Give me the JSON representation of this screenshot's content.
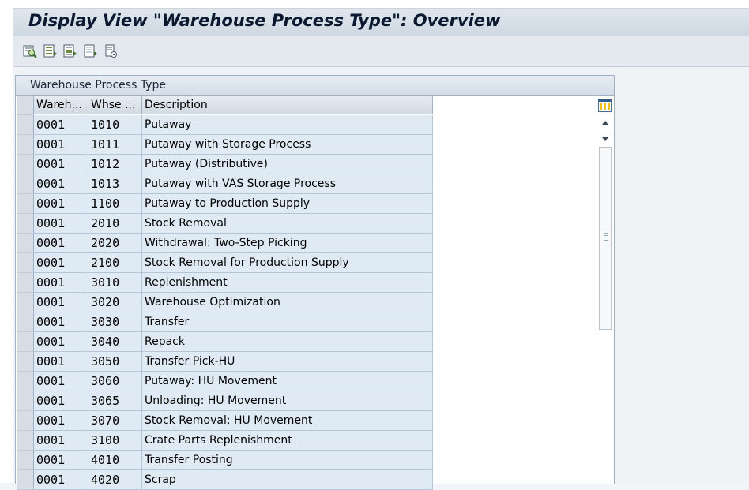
{
  "window": {
    "title": "Display View \"Warehouse Process Type\": Overview"
  },
  "toolbar": {
    "buttons": [
      {
        "name": "display-change-icon"
      },
      {
        "name": "select-all-icon"
      },
      {
        "name": "select-block-icon"
      },
      {
        "name": "deselect-all-icon"
      },
      {
        "name": "print-icon"
      }
    ]
  },
  "panel": {
    "title": "Warehouse Process Type"
  },
  "table": {
    "columns": [
      "Wareh...",
      "Whse ...",
      "Description"
    ],
    "rows": [
      {
        "warehouse": "0001",
        "process_type": "1010",
        "description": "Putaway"
      },
      {
        "warehouse": "0001",
        "process_type": "1011",
        "description": "Putaway with Storage Process"
      },
      {
        "warehouse": "0001",
        "process_type": "1012",
        "description": "Putaway (Distributive)"
      },
      {
        "warehouse": "0001",
        "process_type": "1013",
        "description": "Putaway with VAS Storage Process"
      },
      {
        "warehouse": "0001",
        "process_type": "1100",
        "description": "Putaway to Production Supply"
      },
      {
        "warehouse": "0001",
        "process_type": "2010",
        "description": "Stock Removal"
      },
      {
        "warehouse": "0001",
        "process_type": "2020",
        "description": "Withdrawal: Two-Step Picking"
      },
      {
        "warehouse": "0001",
        "process_type": "2100",
        "description": "Stock Removal for Production Supply"
      },
      {
        "warehouse": "0001",
        "process_type": "3010",
        "description": "Replenishment"
      },
      {
        "warehouse": "0001",
        "process_type": "3020",
        "description": "Warehouse Optimization"
      },
      {
        "warehouse": "0001",
        "process_type": "3030",
        "description": "Transfer"
      },
      {
        "warehouse": "0001",
        "process_type": "3040",
        "description": "Repack"
      },
      {
        "warehouse": "0001",
        "process_type": "3050",
        "description": "Transfer Pick-HU"
      },
      {
        "warehouse": "0001",
        "process_type": "3060",
        "description": "Putaway: HU Movement"
      },
      {
        "warehouse": "0001",
        "process_type": "3065",
        "description": "Unloading: HU Movement"
      },
      {
        "warehouse": "0001",
        "process_type": "3070",
        "description": "Stock Removal: HU Movement"
      },
      {
        "warehouse": "0001",
        "process_type": "3100",
        "description": "Crate Parts Replenishment"
      },
      {
        "warehouse": "0001",
        "process_type": "4010",
        "description": "Transfer Posting"
      },
      {
        "warehouse": "0001",
        "process_type": "4020",
        "description": "Scrap"
      }
    ]
  },
  "colors": {
    "cell_bg": "#dfeaf4",
    "header_bg": "#d2dae3",
    "title_text": "#0a1930"
  }
}
